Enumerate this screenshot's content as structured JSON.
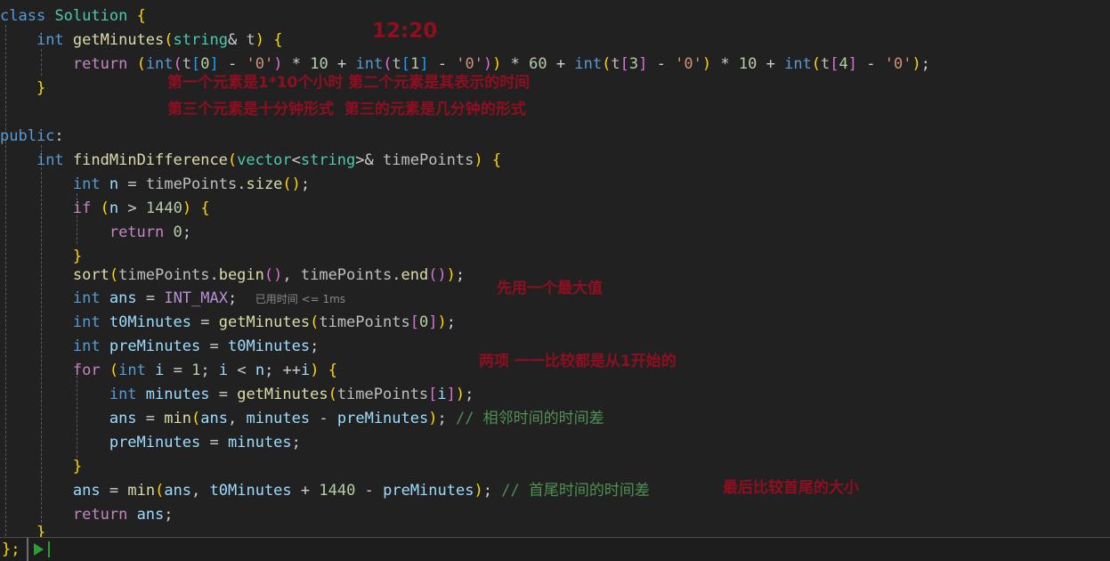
{
  "editor": {
    "background": "#212121",
    "font_size_px": 17,
    "language": "cpp",
    "lines": [
      "class Solution {",
      "    int getMinutes(string& t) {",
      "        return (int(t[0] - '0') * 10 + int(t[1] - '0')) * 60 + int(t[3] - '0') * 10 + int(t[4] - '0');",
      "    }",
      "public:",
      "    int findMinDifference(vector<string>& timePoints) {",
      "        int n = timePoints.size();",
      "        if (n > 1440) {",
      "            return 0;",
      "        }",
      "        sort(timePoints.begin(), timePoints.end());",
      "        int ans = INT_MAX;",
      "        int t0Minutes = getMinutes(timePoints[0]);",
      "        int preMinutes = t0Minutes;",
      "        for (int i = 1; i < n; ++i) {",
      "            int minutes = getMinutes(timePoints[i]);",
      "            ans = min(ans, minutes - preMinutes); // 相邻时间的时间差",
      "            preMinutes = minutes;",
      "        }",
      "        ans = min(ans, t0Minutes + 1440 - preMinutes); // 首尾时间的时间差",
      "        return ans;",
      "    }"
    ],
    "inlay_hint": {
      "label": "已用时间",
      "value": "<= 1ms",
      "color": "#8a8a8a"
    },
    "comments": [
      "// 相邻时间的时间差",
      "// 首尾时间的时间差"
    ]
  },
  "annotations": {
    "color": "#8f0f20",
    "items": [
      {
        "text": "12:20",
        "size": 22
      },
      {
        "text": "第一个元素是1*10个小时 第二个元素是其表示的时间",
        "size": 17
      },
      {
        "text": "第三个元素是十分钟形式  第三的元素是几分钟的形式",
        "size": 17
      },
      {
        "text": "先用一个最大值",
        "size": 17
      },
      {
        "text": "两项 一一比较都是从1开始的",
        "size": 17
      },
      {
        "text": "最后比较首尾的大小",
        "size": 17
      }
    ]
  },
  "status_bar": {
    "closing_brace": "};",
    "run_icon": "play-triangle-icon",
    "run_icon_color": "#2e9e34"
  }
}
